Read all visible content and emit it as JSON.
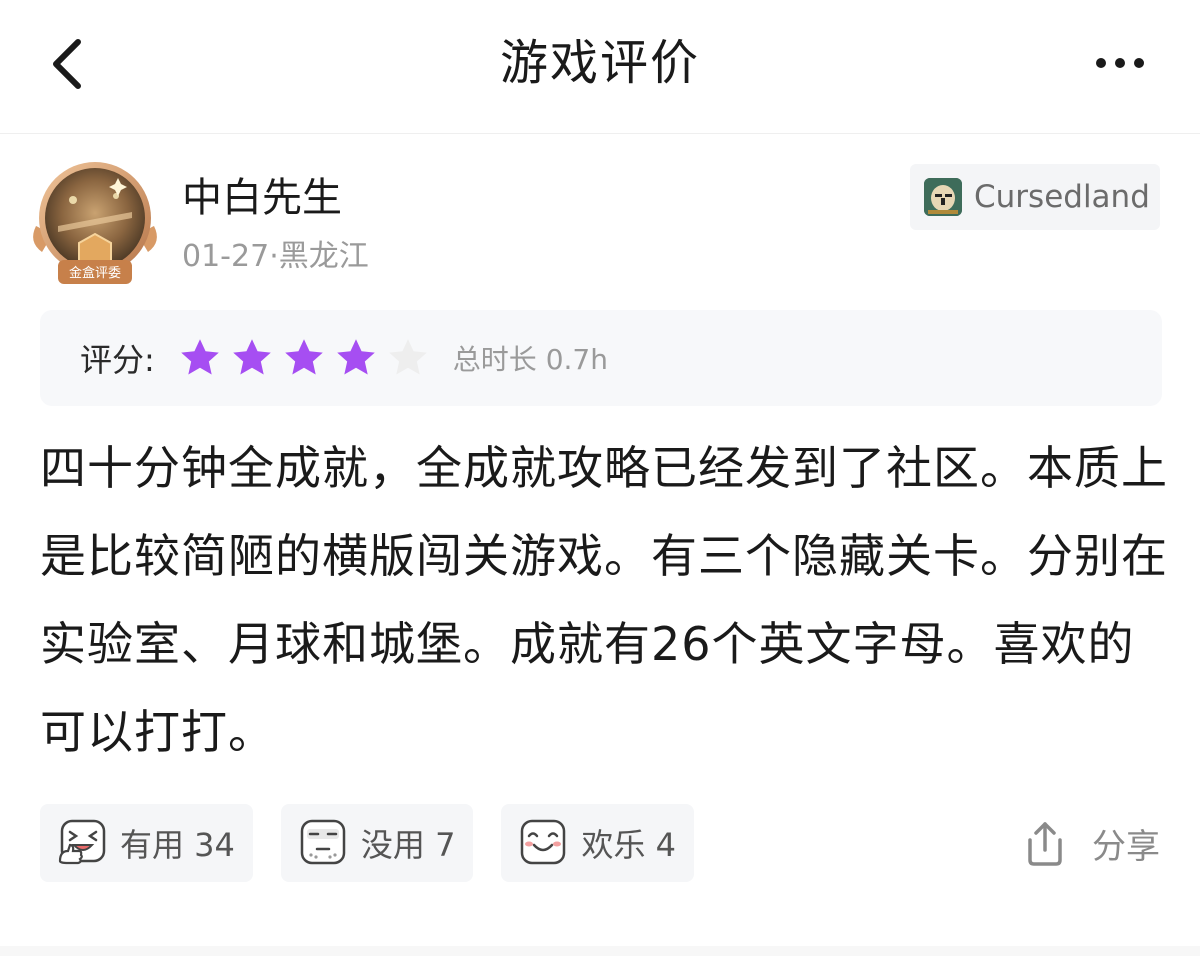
{
  "nav": {
    "title": "游戏评价"
  },
  "author": {
    "name": "中白先生",
    "date": "01-27",
    "separator": "·",
    "location": "黑龙江",
    "badge": "金盒评委"
  },
  "game_tag": {
    "name": "Cursedland"
  },
  "rating": {
    "label": "评分:",
    "stars_filled": 4,
    "stars_total": 5,
    "star_color": "#a64ef2",
    "play_time": "总时长 0.7h"
  },
  "review": {
    "text": "四十分钟全成就，全成就攻略已经发到了社区。本质上是比较简陋的横版闯关游戏。有三个隐藏关卡。分别在实验室、月球和城堡。成就有26个英文字母。喜欢的可以打打。"
  },
  "reactions": [
    {
      "icon": "laugh-thumbs-up-icon",
      "label": "有用 34"
    },
    {
      "icon": "speechless-face-icon",
      "label": "没用 7"
    },
    {
      "icon": "happy-face-icon",
      "label": "欢乐 4"
    }
  ],
  "share": {
    "label": "分享",
    "icon": "share-icon"
  }
}
